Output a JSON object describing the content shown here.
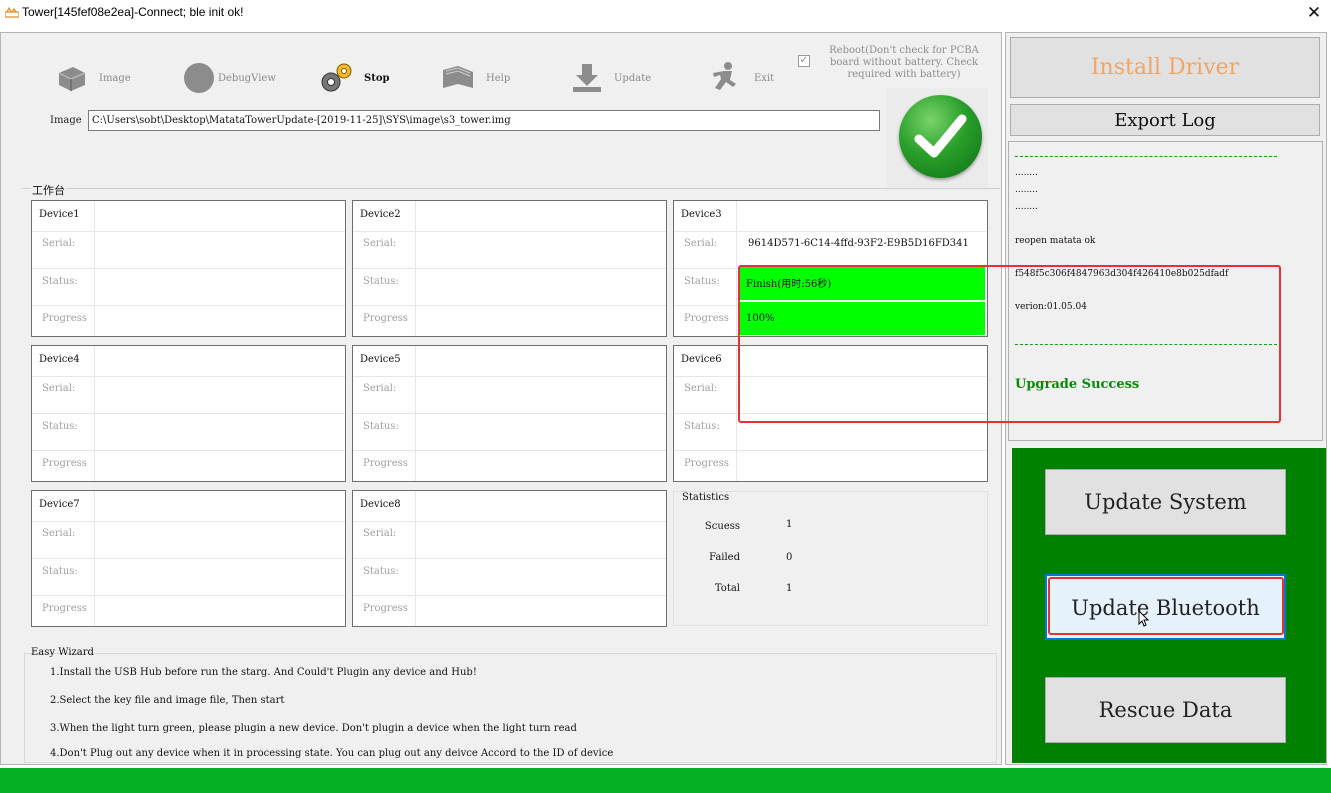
{
  "window": {
    "title": "Tower[145fef08e2ea]-Connect; ble init ok!",
    "close_glyph": "✕"
  },
  "toolbar": {
    "items": [
      {
        "label": "Image",
        "icon": "disk-icon",
        "active": false
      },
      {
        "label": "DebugView",
        "icon": "circle-icon",
        "active": false
      },
      {
        "label": "Stop",
        "icon": "gears-icon",
        "active": true
      },
      {
        "label": "Help",
        "icon": "book-icon",
        "active": false
      },
      {
        "label": "Update",
        "icon": "download-arrow-icon",
        "active": false
      },
      {
        "label": "Exit",
        "icon": "running-man-icon",
        "active": false
      }
    ],
    "reboot_option": {
      "checked": true,
      "text": "Reboot(Don't check for PCBA board without battery. Check required with battery)"
    }
  },
  "image": {
    "label": "Image",
    "path": "C:\\Users\\sobt\\Desktop\\MatataTowerUpdate-[2019-11-25]\\SYS\\image\\s3_tower.img"
  },
  "status_light": {
    "state": "ok",
    "icon": "green-check-icon",
    "color": "#1e9b25"
  },
  "workbench": {
    "label": "工作台",
    "field_labels": {
      "serial": "Serial:",
      "status": "Status:",
      "progress": "Progress"
    },
    "devices": [
      {
        "name": "Device1",
        "serial": "",
        "status": "",
        "progress": ""
      },
      {
        "name": "Device2",
        "serial": "",
        "status": "",
        "progress": ""
      },
      {
        "name": "Device3",
        "serial": "9614D571-6C14-4ffd-93F2-E9B5D16FD341",
        "status": "Finish(用时:56秒)",
        "progress": "100%"
      },
      {
        "name": "Device4",
        "serial": "",
        "status": "",
        "progress": ""
      },
      {
        "name": "Device5",
        "serial": "",
        "status": "",
        "progress": ""
      },
      {
        "name": "Device6",
        "serial": "",
        "status": "",
        "progress": ""
      },
      {
        "name": "Device7",
        "serial": "",
        "status": "",
        "progress": ""
      },
      {
        "name": "Device8",
        "serial": "",
        "status": "",
        "progress": ""
      }
    ],
    "statistics": {
      "title": "Statistics",
      "success_label": "Scuess",
      "success": "1",
      "failed_label": "Failed",
      "failed": "0",
      "total_label": "Total",
      "total": "1"
    }
  },
  "wizard": {
    "title": "Easy Wizard",
    "lines": [
      "1.Install the USB Hub before run the starg. And Could't Plugin any device and Hub!",
      "2.Select the key file and image file, Then start",
      "3.When the light turn green, please plugin a new device. Don't plugin a device when the light turn read",
      "4.Don't Plug out any device when it in processing state. You can plug out any deivce Accord to the ID of device"
    ]
  },
  "right": {
    "install_driver": "Install Driver",
    "export_log": "Export Log",
    "log": {
      "dots": [
        "........",
        "........",
        "........"
      ],
      "reopen": "reopen matata ok",
      "hash": "f548f5c306f4847963d304f426410e8b025dfadf",
      "version": "verion:01.05.04",
      "success": "Upgrade Success"
    },
    "buttons": {
      "update_system": "Update System",
      "update_bluetooth": "Update Bluetooth",
      "rescue_data": "Rescue Data"
    }
  },
  "colors": {
    "accent_green": "#008000",
    "finish_green": "#00ff00",
    "highlight_red": "#e53131",
    "install_orange": "#f4a460",
    "progress_green": "#06b025"
  }
}
